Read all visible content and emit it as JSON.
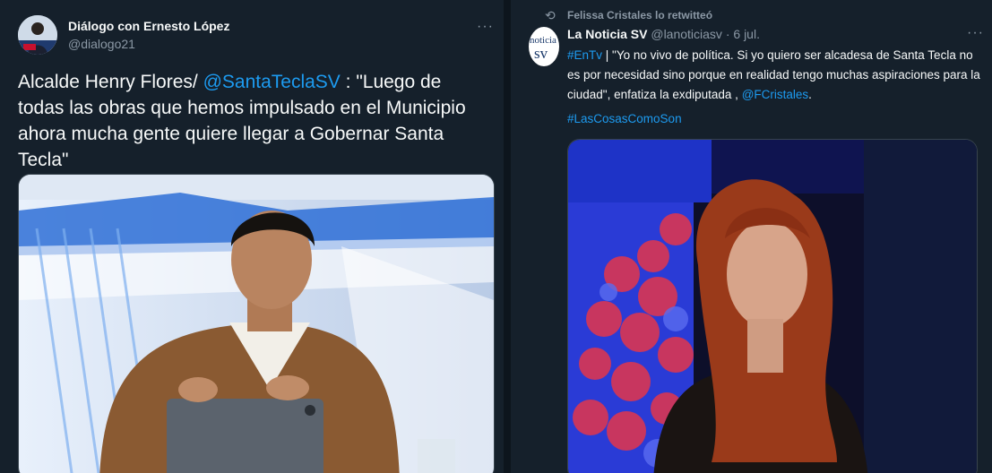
{
  "left_tweet": {
    "author_name": "Diálogo con Ernesto López",
    "author_handle": "@dialogo21",
    "more_label": "···",
    "text_before": "Alcalde Henry Flores/ ",
    "mention": "@SantaTeclaSV",
    "text_after": " : \"Luego de todas las obras que hemos impulsado en el Municipio ahora mucha gente quiere llegar a Gobernar Santa Tecla\"",
    "avatar_icon": "tv-host-avatar-icon"
  },
  "right_tweet": {
    "retweet_note": "Felissa Cristales lo retwitteó",
    "retweet_icon": "retweet-icon",
    "author_name": "La Noticia SV",
    "author_handle": "@lanoticiasv",
    "separator": "·",
    "date": "6 jul.",
    "more_label": "···",
    "hashtag1": "#EnTv",
    "text_main": " | \"Yo no vivo de política. Si yo quiero ser alcadesa de Santa Tecla no es por necesidad sino porque en realidad tengo muchas aspiraciones para la ciudad\", enfatiza la exdiputada , ",
    "mention": "@FCristales",
    "text_end": ".",
    "hashtag2": "#LasCosasComoSon",
    "avatar_text_top": "noticia",
    "avatar_text_bottom": "sv"
  },
  "colors": {
    "background": "#15202b",
    "link": "#1d9bf0",
    "secondary_text": "#8b98a5"
  }
}
